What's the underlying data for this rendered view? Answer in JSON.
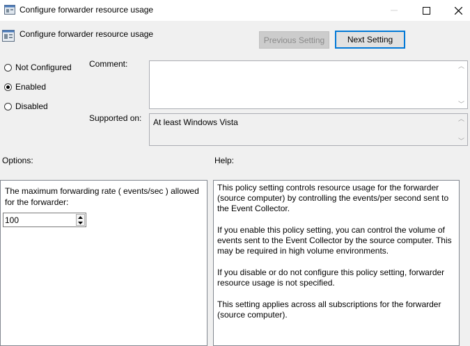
{
  "window": {
    "title": "Configure forwarder resource usage"
  },
  "header": {
    "title": "Configure forwarder resource usage",
    "prev_label": "Previous Setting",
    "next_label": "Next Setting"
  },
  "state": {
    "options": [
      "Not Configured",
      "Enabled",
      "Disabled"
    ],
    "selected": "Enabled"
  },
  "labels": {
    "comment": "Comment:",
    "supported_on": "Supported on:",
    "options": "Options:",
    "help": "Help:"
  },
  "supported_on_value": "At least Windows Vista",
  "comment_value": "",
  "options_panel": {
    "rate_label": "The maximum forwarding rate ( events/sec ) allowed for the forwarder:",
    "rate_value": "100"
  },
  "help_text": [
    "This policy setting controls resource usage for the forwarder (source computer) by controlling the events/per second sent to the Event Collector.",
    "If you enable this policy setting, you can control the volume of events sent to the Event Collector by the source computer. This may be required in high volume environments.",
    "If you disable or do not configure this policy setting, forwarder resource usage is not specified.",
    "This setting applies across all subscriptions for the forwarder (source computer)."
  ],
  "colors": {
    "accent": "#0078d7",
    "disabled_button": "#cccccc",
    "window_bg": "#f0f0f0"
  },
  "icons": [
    "policy-icon",
    "minimize-icon",
    "maximize-icon",
    "close-icon",
    "spin-up-icon",
    "spin-down-icon"
  ]
}
